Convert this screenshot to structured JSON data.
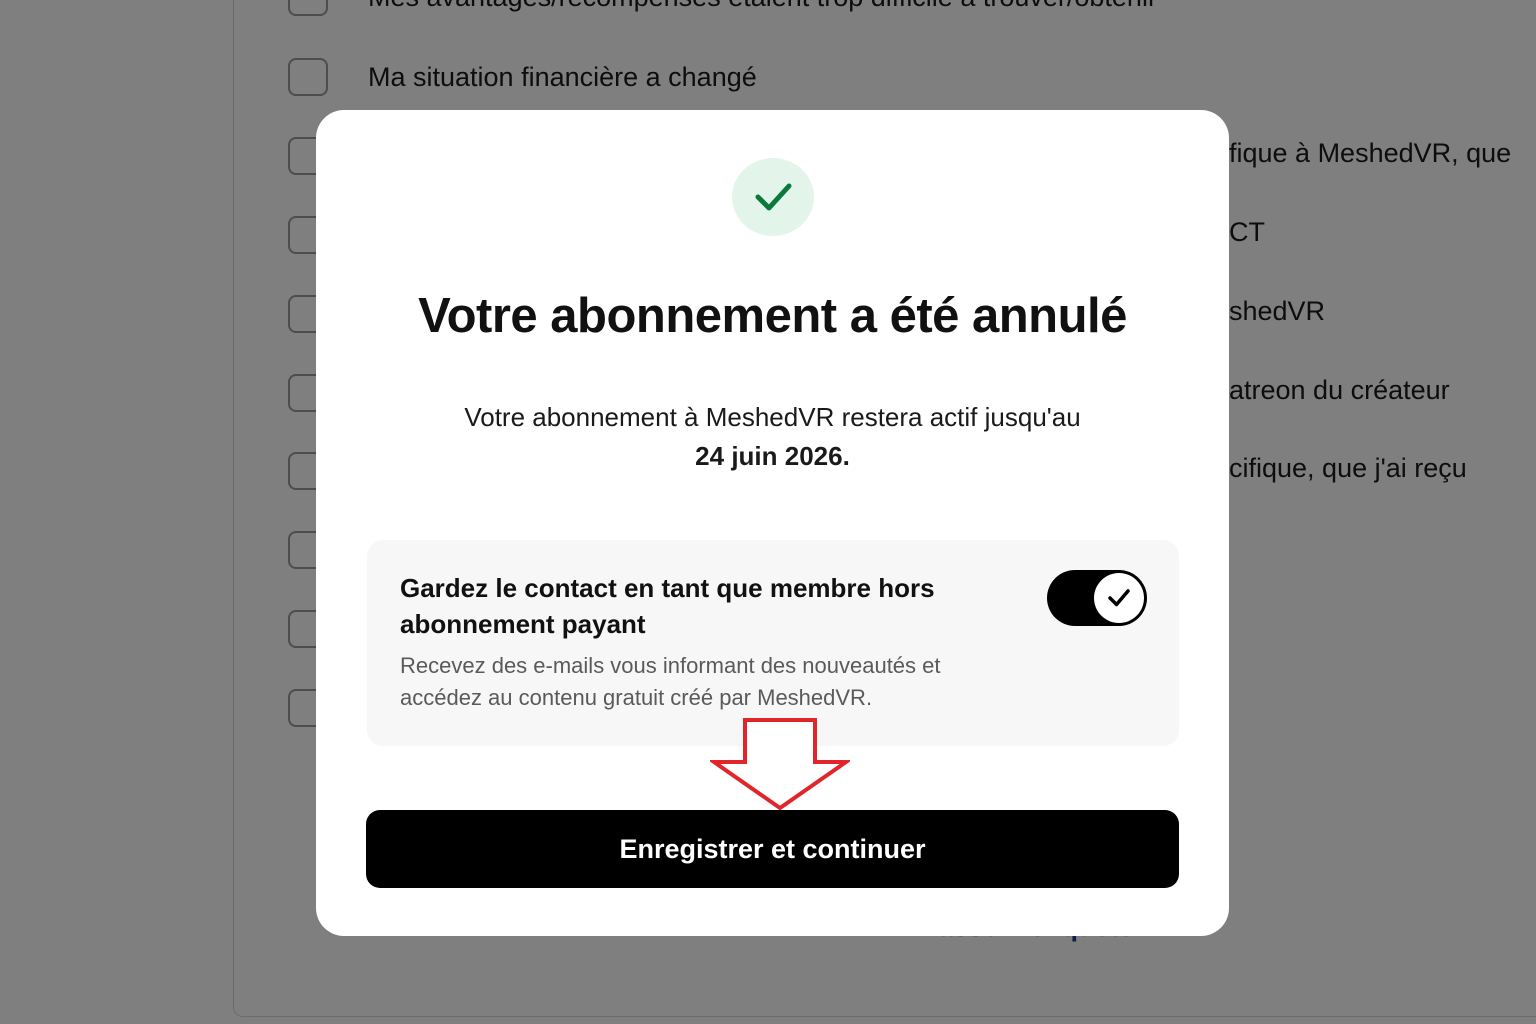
{
  "survey": {
    "options": [
      {
        "label": "Mes avantages/récompenses étaient trop difficile à trouver/obtenir"
      },
      {
        "label": "Ma situation financière a changé"
      },
      {
        "label": "fique à MeshedVR, que"
      },
      {
        "label": "CT"
      },
      {
        "label": "shedVR"
      },
      {
        "label": "atreon du créateur"
      },
      {
        "label": "cifique, que j'ai reçu"
      },
      {
        "label": ""
      },
      {
        "label": ""
      },
      {
        "label": ""
      }
    ],
    "link_label": "Passer l'enquête"
  },
  "modal": {
    "icon": "check-icon",
    "icon_color": "#0a7a3b",
    "badge_color": "#e3f5ea",
    "title": "Votre abonnement a été annulé",
    "message": "Votre abonnement à MeshedVR restera actif jusqu'au",
    "date": "24 juin 2026",
    "date_suffix": ".",
    "follow_card": {
      "title": "Gardez le contact en tant que membre hors abonnement payant",
      "description": "Recevez des e-mails vous informant des nouveautés et accédez au contenu gratuit créé par MeshedVR.",
      "toggle_on": true
    },
    "save_button": "Enregistrer et continuer"
  },
  "annotation": {
    "icon": "arrow-down-icon",
    "color": "#e0262b"
  }
}
